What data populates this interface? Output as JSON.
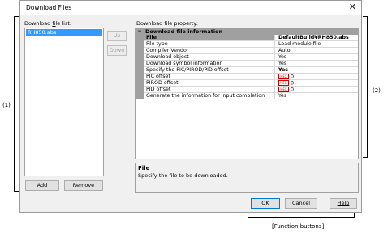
{
  "window": {
    "title": "Download Files"
  },
  "file_list": {
    "label_prefix": "Download ",
    "label_mnemonic": "f",
    "label_suffix": "ile list:",
    "items": [
      "RH850.abs"
    ]
  },
  "buttons": {
    "up": "Up",
    "down": "Down",
    "add": "Add",
    "remove": "Remove",
    "ok": "OK",
    "cancel": "Cancel",
    "help": "Help"
  },
  "property": {
    "label": "Download file property:",
    "category": "Download file information",
    "category_toggle": "−",
    "hex_badge": "HEX",
    "rows": [
      {
        "name": "File",
        "value": "DefaultBuild¥RH850.abs"
      },
      {
        "name": "File type",
        "value": "Load module file"
      },
      {
        "name": "Compiler Vendor",
        "value": "Auto"
      },
      {
        "name": "Download object",
        "value": "Yes"
      },
      {
        "name": "Download symbol information",
        "value": "Yes"
      },
      {
        "name": "Specify the PIC/PIROD/PID offset",
        "value": "Yes"
      },
      {
        "name": "PIC offset",
        "value": "0"
      },
      {
        "name": "PIROD offset",
        "value": "0"
      },
      {
        "name": "PID offset",
        "value": "0"
      },
      {
        "name": "Generate the information for input completion",
        "value": "Yes"
      }
    ]
  },
  "description": {
    "title": "File",
    "text": "Specify the file to be downloaded."
  },
  "annotations": {
    "left": "(1)",
    "right": "(2)",
    "function_buttons": "[Function buttons]"
  },
  "colors": {
    "selection": "#3399ff",
    "grid_gray": "#a0a0a0",
    "hex_red": "#cc0000",
    "default_button_border": "#0078d7"
  }
}
